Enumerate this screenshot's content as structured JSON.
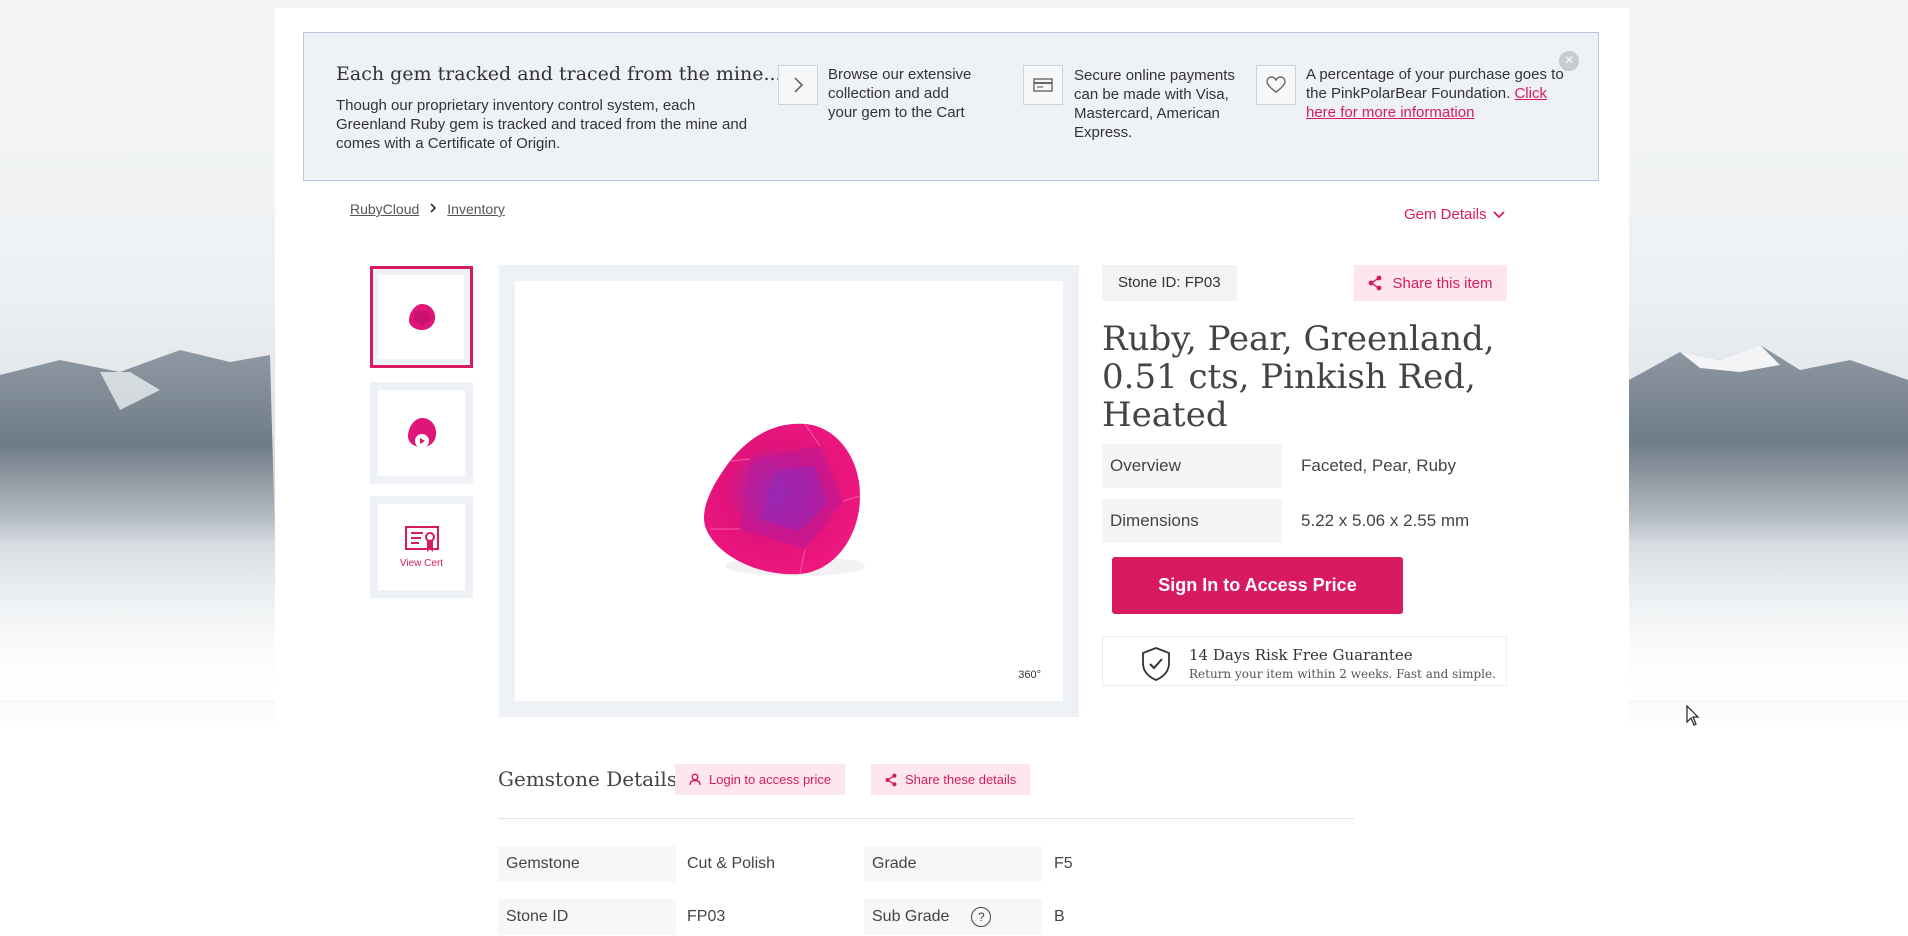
{
  "notice": {
    "heading": "Each gem tracked and traced from the mine...",
    "lead": "Though our proprietary inventory control system, each Greenland Ruby gem is tracked and traced from the mine and comes with a Certificate of Origin.",
    "items": [
      {
        "icon": "chevron-right-icon",
        "text": "Browse our extensive collection and add your gem to the Cart"
      },
      {
        "icon": "credit-card-icon",
        "text": "Secure online payments can be made with Visa, Mastercard, American Express."
      },
      {
        "icon": "heart-icon",
        "text": "A percentage of your purchase goes to the PinkPolarBear Foundation. ",
        "link": "Click here for more information"
      }
    ],
    "close": "×"
  },
  "breadcrumb": [
    "RubyCloud",
    "Inventory"
  ],
  "gem_details_link": "Gem Details",
  "thumbs": {
    "cert_label": "View Cert"
  },
  "viewer": {
    "badge": "360°"
  },
  "stone_id_label": "Stone ID: FP03",
  "share_item": "Share this item",
  "title": "Ruby, Pear, Greenland, 0.51 cts, Pinkish Red, Heated",
  "specs": [
    {
      "k": "Overview",
      "v": "Faceted, Pear, Ruby"
    },
    {
      "k": "Dimensions",
      "v": "5.22 x 5.06 x 2.55 mm"
    }
  ],
  "signin": "Sign In to Access Price",
  "guarantee": {
    "title": "14 Days Risk Free Guarantee",
    "sub": "Return your item within 2 weeks. Fast and simple."
  },
  "gemstone_details": {
    "title": "Gemstone Details",
    "login_pill": "Login to access price",
    "share_pill": "Share these details",
    "rows": [
      {
        "k1": "Gemstone",
        "v1": "Cut & Polish",
        "k2": "Grade",
        "v2": "F5"
      },
      {
        "k1": "Stone ID",
        "v1": "FP03",
        "k2": "Sub Grade",
        "v2": "B",
        "help": "?"
      }
    ]
  },
  "colors": {
    "accent": "#d81b60",
    "panel": "#eef1f6"
  }
}
